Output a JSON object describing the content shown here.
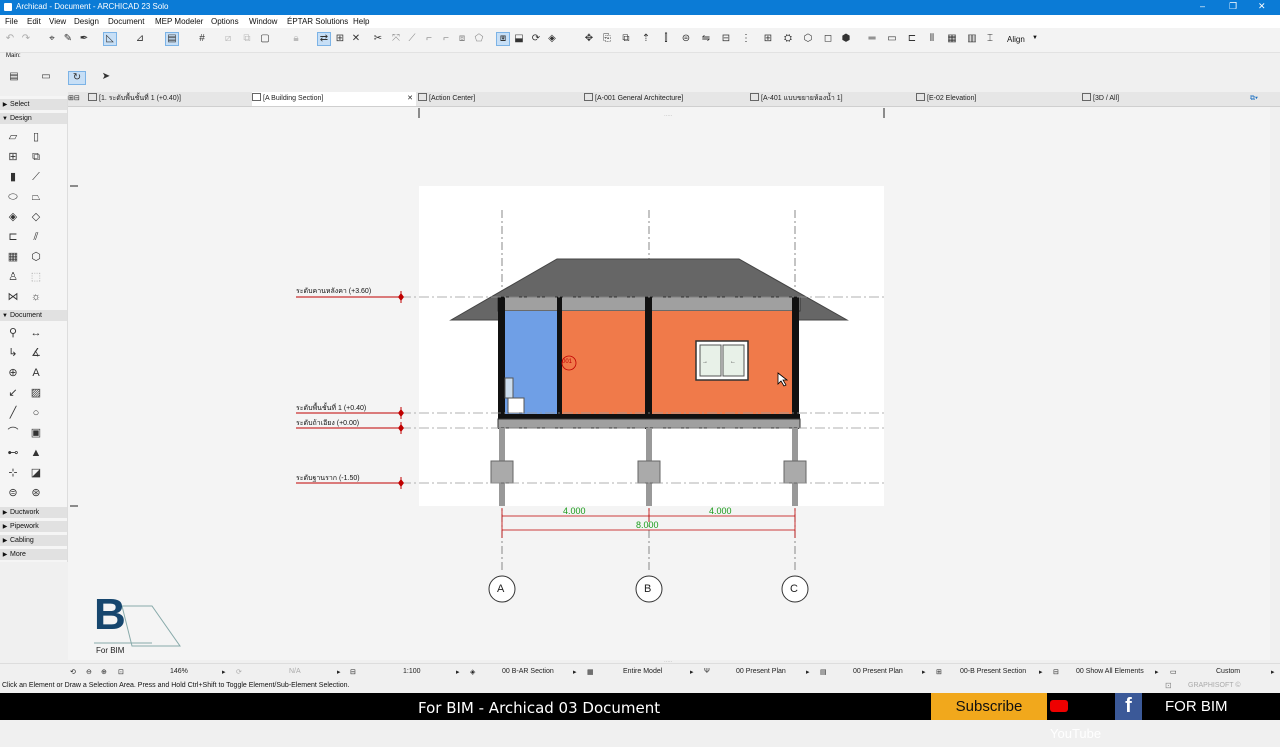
{
  "window": {
    "title": "Archicad - Document - ARCHICAD 23 Solo"
  },
  "menu": [
    "File",
    "Edit",
    "View",
    "Design",
    "Document",
    "MEP Modeler",
    "Options",
    "Window",
    "ÉPTAR Solutions",
    "Help"
  ],
  "toolbar": {
    "align_label": "Align",
    "main_label": "Main:"
  },
  "tabs": [
    {
      "label": "[1. ระดับพื้นชั้นที่ 1 (+0.40)]"
    },
    {
      "label": "[A Building Section]"
    },
    {
      "label": "[Action Center]"
    },
    {
      "label": "[A-001 General Architecture]"
    },
    {
      "label": "[A-401 แบบขยายห้องน้ำ 1]"
    },
    {
      "label": "[E-02 Elevation]"
    },
    {
      "label": "[3D / All]"
    }
  ],
  "toolbox": {
    "select": "Select",
    "design": "Design",
    "document": "Document",
    "ductwork": "Ductwork",
    "pipework": "Pipework",
    "cabling": "Cabling",
    "more": "More"
  },
  "levels": [
    {
      "label": "ระดับคานหลังคา (+3.60)"
    },
    {
      "label": "ระดับพื้นชั้นที่ 1 (+0.40)"
    },
    {
      "label": "ระดับถ้าเอียง (+0.00)"
    },
    {
      "label": "ระดับฐานราก (-1.50)"
    }
  ],
  "zone_label": "001",
  "dimensions": {
    "d1": "4.000",
    "d2": "4.000",
    "total": "8.000"
  },
  "grid_labels": [
    "A",
    "B",
    "C"
  ],
  "status": {
    "zoom": "146%",
    "angle": "N/A",
    "scale": "1:100",
    "layer": "00 B-AR Section",
    "model": "Entire Model",
    "plan1": "00 Present Plan",
    "plan2": "00 Present Plan",
    "section": "00-B Present Section",
    "elements": "00 Show All Elements",
    "custom": "Custom"
  },
  "hint": "Click an Element or Draw a Selection Area. Press and Hold Ctrl+Shift to Toggle Element/Sub-Element Selection.",
  "graphisoft": "GRAPHISOFT ©",
  "banner": {
    "title": "For BIM - Archicad 03 Document",
    "subscribe": "Subscribe",
    "youtube": "YouTube",
    "facebook": "f",
    "brand": "FOR BIM"
  },
  "logo": {
    "letter": "B",
    "caption": "For BIM"
  },
  "colors": {
    "titlebar": "#0b7bd6",
    "room_orange": "#f07a4a",
    "room_blue": "#6f9fe6",
    "roof": "#666666",
    "level_red": "#c00000",
    "dim_green": "#1a9c1a"
  }
}
